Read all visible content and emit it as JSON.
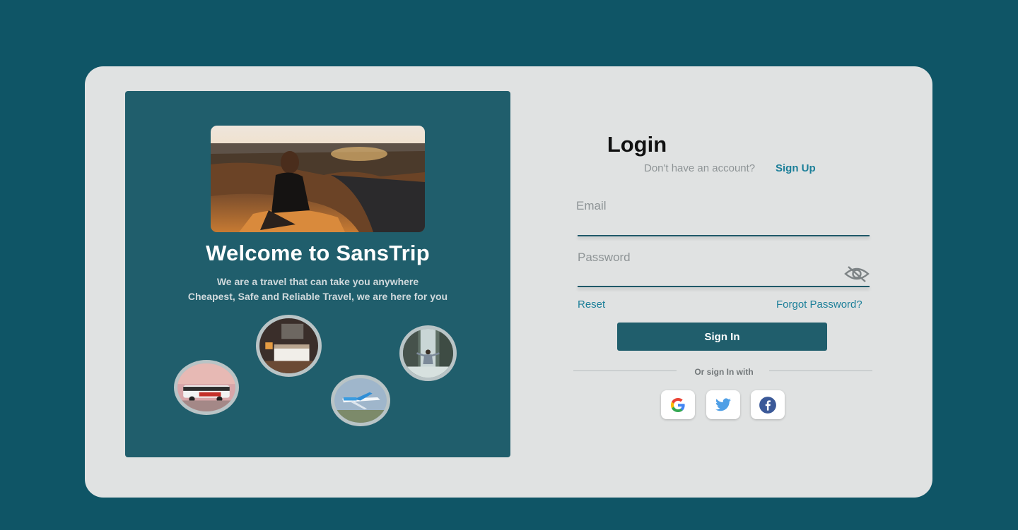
{
  "hero": {
    "title": "Welcome to SansTrip",
    "subtitle_line1": "We are a travel that can take you anywhere",
    "subtitle_line2": "Cheapest, Safe and Reliable Travel, we are here for you"
  },
  "login": {
    "title": "Login",
    "no_account_text": "Don't have an account?",
    "signup_link": "Sign Up",
    "email_label": "Email",
    "password_label": "Password",
    "reset_link": "Reset",
    "forgot_link": "Forgot Password?",
    "signin_button": "Sign In",
    "or_text": "Or sign In with",
    "social": [
      "google-icon",
      "twitter-icon",
      "facebook-icon"
    ]
  },
  "colors": {
    "background": "#0f5566",
    "card": "#e0e2e2",
    "panel": "#205e6c",
    "accent": "#1c7f99"
  }
}
